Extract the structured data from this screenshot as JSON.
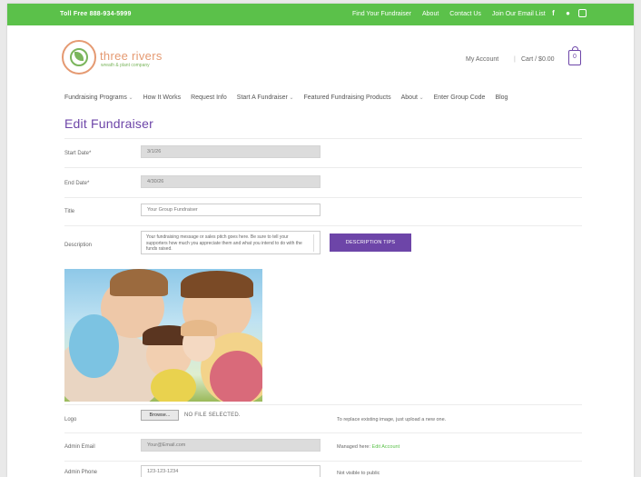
{
  "topbar": {
    "phone": "Toll Free 888-934-5999",
    "links": [
      "Find Your Fundraiser",
      "About",
      "Contact Us",
      "Join Our Email List"
    ]
  },
  "logo": {
    "name": "three rivers",
    "tagline": "wreath & plant company"
  },
  "header": {
    "account": "My Account",
    "cart": "Cart / $0.00",
    "cart_count": "0"
  },
  "nav": [
    {
      "label": "Fundraising Programs",
      "dropdown": true
    },
    {
      "label": "How It Works",
      "dropdown": false
    },
    {
      "label": "Request Info",
      "dropdown": false
    },
    {
      "label": "Start A Fundraiser",
      "dropdown": true
    },
    {
      "label": "Featured Fundraising Products",
      "dropdown": false
    },
    {
      "label": "About",
      "dropdown": true
    },
    {
      "label": "Enter Group Code",
      "dropdown": false
    },
    {
      "label": "Blog",
      "dropdown": false
    }
  ],
  "page_title": "Edit Fundraiser",
  "form": {
    "start_date": {
      "label": "Start Date*",
      "value": "3/1/26"
    },
    "end_date": {
      "label": "End Date*",
      "value": "4/30/26"
    },
    "title": {
      "label": "Title",
      "value": "Your Group Fundraiser"
    },
    "description": {
      "label": "Description",
      "value": "Your fundraising message or sales pitch goes here. Be sure to tell your supporters how much you appreciate them and what you intend to do with the funds raised."
    },
    "description_tips_button": "DESCRIPTION TIPS",
    "logo": {
      "label": "Logo",
      "browse": "Browse...",
      "no_file": "NO FILE SELECTED.",
      "note": "To replace existing image, just upload a new one."
    },
    "admin_email": {
      "label": "Admin Email",
      "value": "Your@Email.com",
      "note": "Managed here:",
      "link": "Edit Account"
    },
    "admin_phone": {
      "label": "Admin Phone",
      "value": "123-123-1234",
      "note": "Not visible to public"
    }
  },
  "colors": {
    "topbar": "#5bc14a",
    "accent": "#6d45a8"
  },
  "icons": [
    "facebook-icon",
    "pinterest-icon",
    "instagram-icon"
  ]
}
